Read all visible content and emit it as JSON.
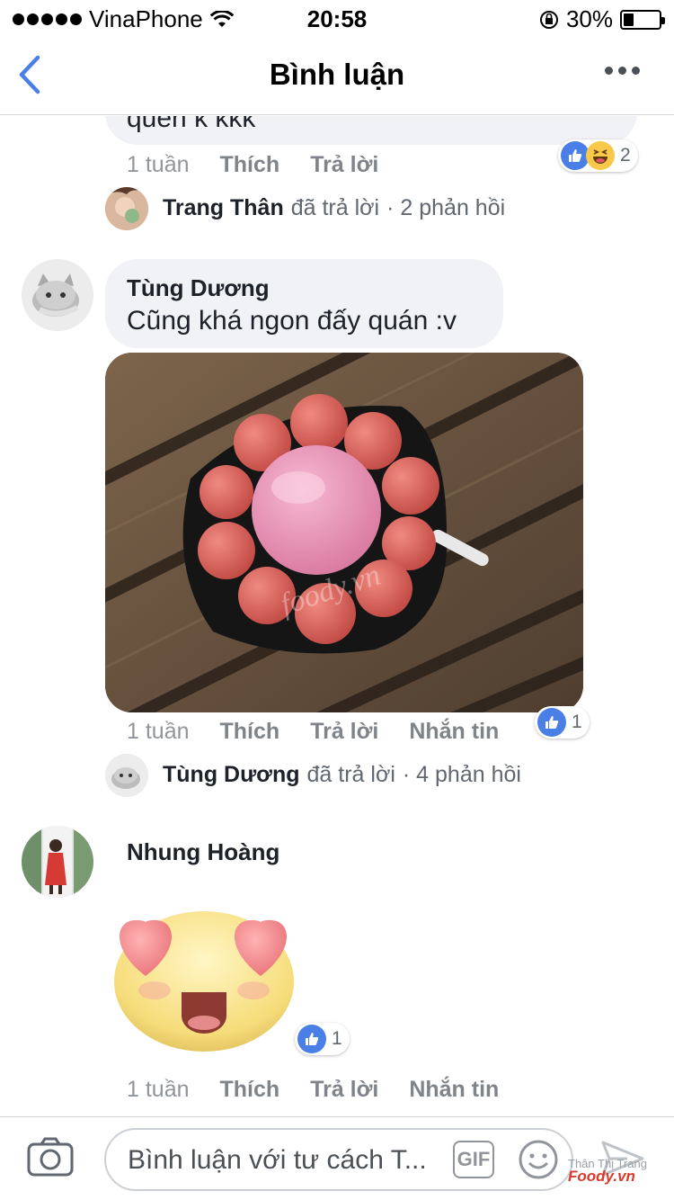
{
  "status_bar": {
    "carrier": "VinaPhone",
    "time": "20:58",
    "battery": "30%",
    "battery_level": 0.3
  },
  "nav": {
    "title": "Bình luận",
    "back_icon": "chevron-left-icon",
    "more_icon": "more-dots-icon"
  },
  "comments": [
    {
      "text": "quên k kkk",
      "time": "1 tuần",
      "like": "Thích",
      "reply": "Trả lời",
      "reaction_count": "2",
      "reply_summary": {
        "name": "Trang Thân",
        "action": "đã trả lời",
        "count": "· 2 phản hồi"
      }
    },
    {
      "author": "Tùng Dương",
      "text": "Cũng khá ngon đấy quán :v",
      "time": "1 tuần",
      "like": "Thích",
      "reply": "Trả lời",
      "message": "Nhắn tin",
      "reaction_count": "1",
      "photo_watermark": "foody.vn",
      "reply_summary": {
        "name": "Tùng Dương",
        "action": "đã trả lời",
        "count": "· 4 phản hồi"
      }
    },
    {
      "author": "Nhung Hoàng",
      "sticker": "heart-eyes-emoji",
      "time": "1 tuần",
      "like": "Thích",
      "reply": "Trả lời",
      "message": "Nhắn tin",
      "reaction_count": "1"
    }
  ],
  "composer": {
    "placeholder": "Bình luận với tư cách T...",
    "gif_label": "GIF"
  },
  "watermark": {
    "name": "Thân Thị Trang",
    "brand": "Foody.vn"
  },
  "colors": {
    "accent": "#4a7fe8",
    "bubble": "#f1f2f6",
    "meta": "#90949c"
  }
}
